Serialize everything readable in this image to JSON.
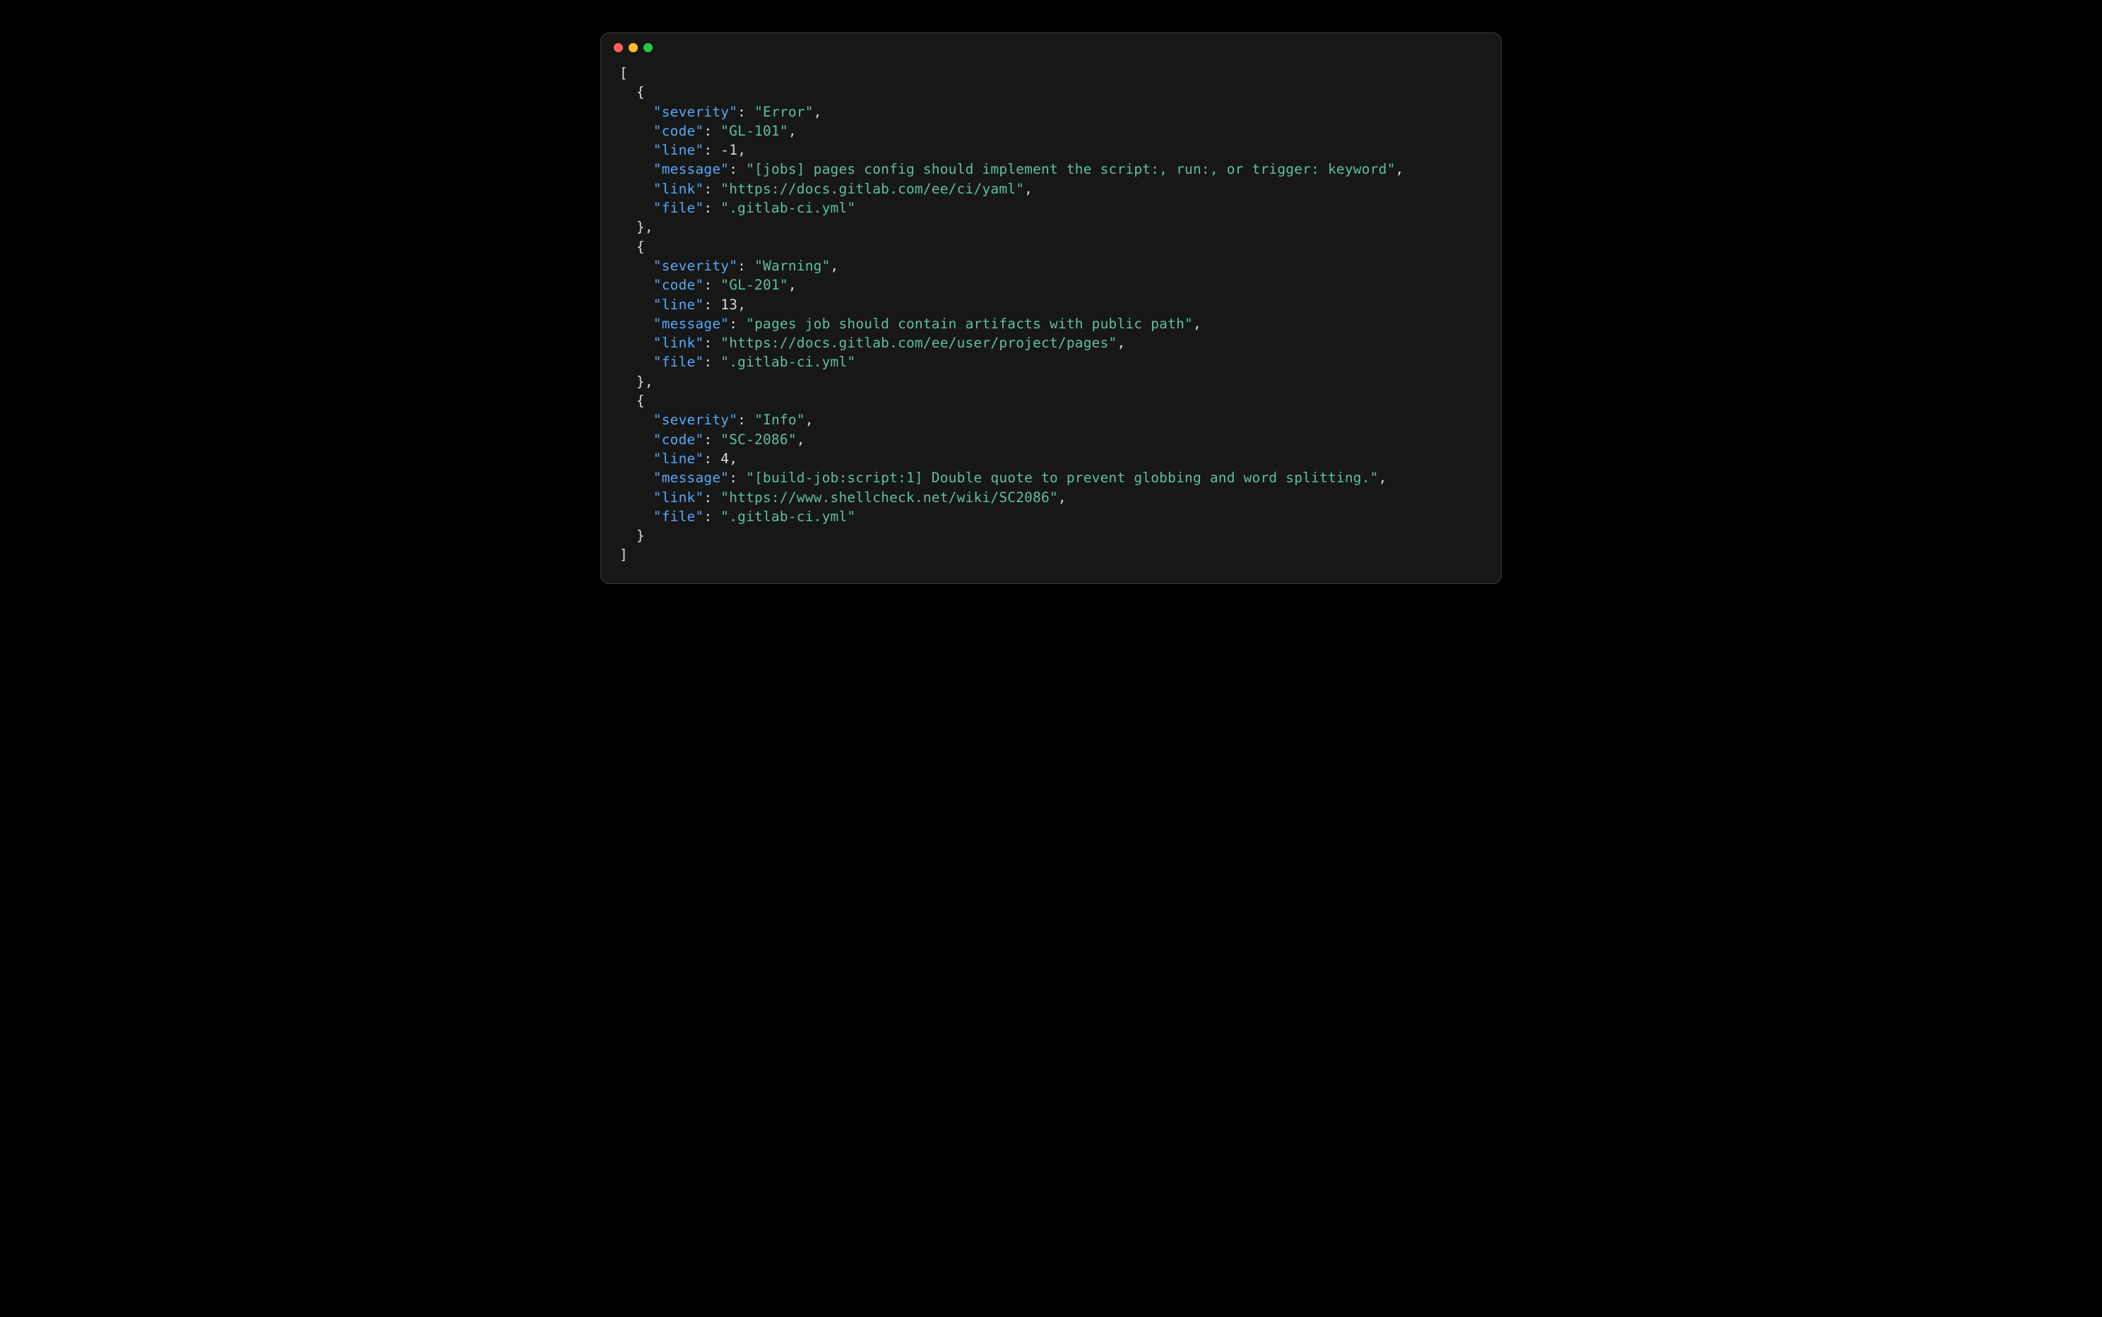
{
  "colors": {
    "window_bg": "#171717",
    "border": "#3a3a3a",
    "key": "#56a8f5",
    "string": "#5fbf9f",
    "number": "#d7d7d7",
    "punct": "#d7d7d7",
    "traffic_red": "#ff5f56",
    "traffic_yellow": "#ffbd2e",
    "traffic_green": "#27c93f"
  },
  "indent": "  ",
  "property_order": [
    "severity",
    "code",
    "line",
    "message",
    "link",
    "file"
  ],
  "json_array": [
    {
      "severity": "Error",
      "code": "GL-101",
      "line": -1,
      "message": "[jobs] pages config should implement the script:, run:, or trigger: keyword",
      "link": "https://docs.gitlab.com/ee/ci/yaml",
      "file": ".gitlab-ci.yml"
    },
    {
      "severity": "Warning",
      "code": "GL-201",
      "line": 13,
      "message": "pages job should contain artifacts with public path",
      "link": "https://docs.gitlab.com/ee/user/project/pages",
      "file": ".gitlab-ci.yml"
    },
    {
      "severity": "Info",
      "code": "SC-2086",
      "line": 4,
      "message": "[build-job:script:1] Double quote to prevent globbing and word splitting.",
      "link": "https://www.shellcheck.net/wiki/SC2086",
      "file": ".gitlab-ci.yml"
    }
  ]
}
